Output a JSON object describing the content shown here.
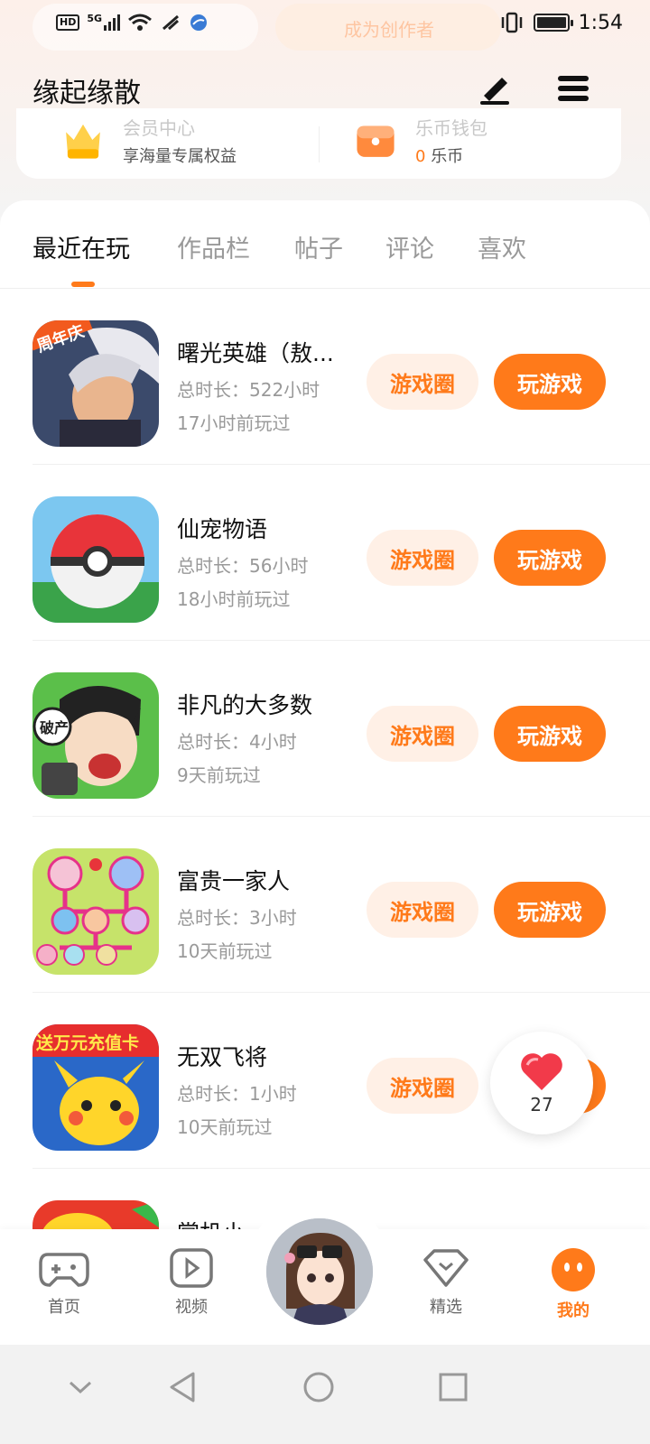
{
  "status_bar": {
    "hd": "HD",
    "network": "5G",
    "time": "1:54"
  },
  "background": {
    "left_pill_text": "",
    "right_pill_text": "成为创作者"
  },
  "header": {
    "title": "缘起缘散",
    "edit_icon": "pencil-icon",
    "menu_icon": "hamburger-icon"
  },
  "member_card": {
    "vip_title": "会员中心",
    "vip_sub": "享海量专属权益",
    "wallet_title": "乐币钱包",
    "wallet_amount": "0",
    "wallet_unit": "乐币"
  },
  "tabs": [
    {
      "label": "最近在玩",
      "active": true
    },
    {
      "label": "作品栏",
      "active": false
    },
    {
      "label": "帖子",
      "active": false
    },
    {
      "label": "评论",
      "active": false
    },
    {
      "label": "喜欢",
      "active": false
    }
  ],
  "games": [
    {
      "name": "曙光英雄（敖...",
      "duration": "总时长：522小时",
      "last_played": "17小时前玩过",
      "icon_badge": "周年庆"
    },
    {
      "name": "仙宠物语",
      "duration": "总时长：56小时",
      "last_played": "18小时前玩过"
    },
    {
      "name": "非凡的大多数",
      "duration": "总时长：4小时",
      "last_played": "9天前玩过",
      "icon_badge": "破产"
    },
    {
      "name": "富贵一家人",
      "duration": "总时长：3小时",
      "last_played": "10天前玩过"
    },
    {
      "name": "无双飞将",
      "duration": "总时长：1小时",
      "last_played": "10天前玩过",
      "icon_badge": "送万元充值卡"
    },
    {
      "name": "掌机小"
    }
  ],
  "buttons": {
    "circle": "游戏圈",
    "play": "玩游戏"
  },
  "like_float": {
    "count": "27"
  },
  "bottom_nav": [
    {
      "label": "首页",
      "icon": "gamepad-icon"
    },
    {
      "label": "视频",
      "icon": "video-play-icon"
    },
    {
      "label": "精选",
      "icon": "heart-diamond-icon"
    },
    {
      "label": "我的",
      "icon": "face-icon",
      "active": true
    }
  ],
  "colors": {
    "accent": "#ff7a1a",
    "accent_light": "#fff0e6"
  }
}
